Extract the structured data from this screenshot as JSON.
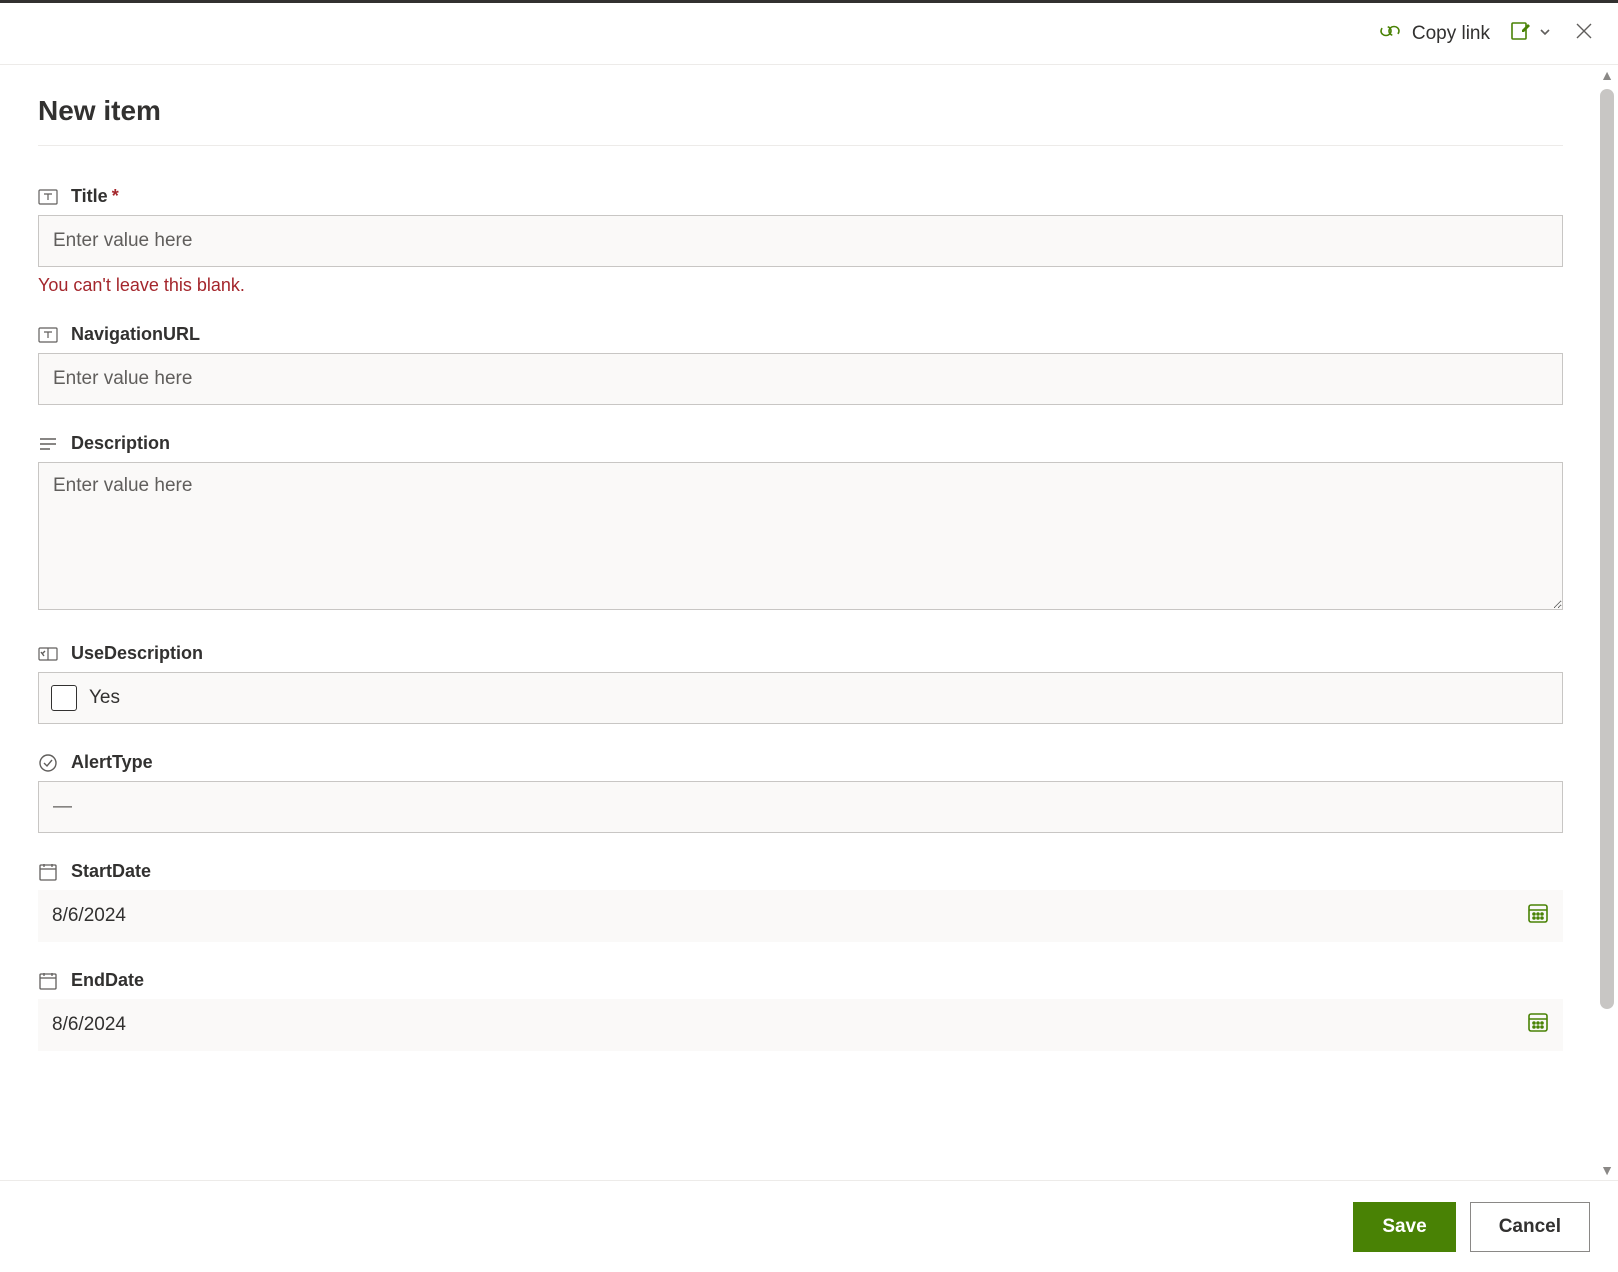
{
  "header": {
    "copy_link_label": "Copy link"
  },
  "page": {
    "title": "New item"
  },
  "fields": {
    "title": {
      "label": "Title",
      "placeholder": "Enter value here",
      "error": "You can't leave this blank."
    },
    "navigation_url": {
      "label": "NavigationURL",
      "placeholder": "Enter value here"
    },
    "description": {
      "label": "Description",
      "placeholder": "Enter value here"
    },
    "use_description": {
      "label": "UseDescription",
      "option_label": "Yes"
    },
    "alert_type": {
      "label": "AlertType",
      "value": "—"
    },
    "start_date": {
      "label": "StartDate",
      "value": "8/6/2024"
    },
    "end_date": {
      "label": "EndDate",
      "value": "8/6/2024"
    }
  },
  "footer": {
    "save_label": "Save",
    "cancel_label": "Cancel"
  }
}
